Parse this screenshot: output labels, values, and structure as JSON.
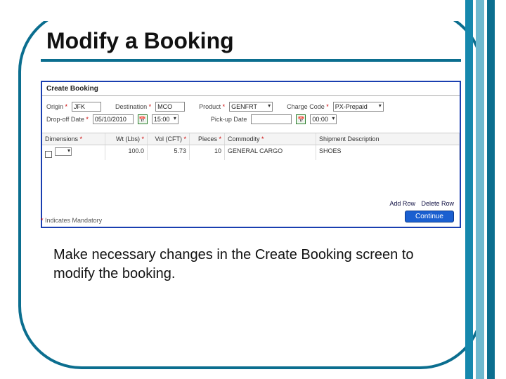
{
  "title": "Modify a Booking",
  "caption": "Make necessary changes in the Create Booking screen to modify the booking.",
  "panel": {
    "heading": "Create Booking",
    "marker": "*",
    "row1": {
      "origin_label": "Origin",
      "origin_value": "JFK",
      "dest_label": "Destination",
      "dest_value": "MCO",
      "product_label": "Product",
      "product_value": "GENFRT",
      "charge_label": "Charge Code",
      "charge_value": "PX-Prepaid"
    },
    "row2": {
      "dropoff_label": "Drop-off Date",
      "dropoff_value": "05/10/2010",
      "dropoff_time": "15:00",
      "pickup_label": "Pick-up Date",
      "pickup_value": "",
      "pickup_time": "00:00"
    },
    "columns": {
      "dim": "Dimensions",
      "wt": "Wt (Lbs)",
      "vol": "Vol (CFT)",
      "pcs": "Pieces",
      "commodity": "Commodity",
      "shipdesc": "Shipment Description"
    },
    "data": {
      "wt": "100.0",
      "vol": "5.73",
      "pcs": "10",
      "commodity": "GENERAL CARGO",
      "shipdesc": "SHOES"
    },
    "links": {
      "add": "Add Row",
      "del": "Delete Row"
    },
    "mandatory": "Indicates Mandatory",
    "continue": "Continue"
  }
}
